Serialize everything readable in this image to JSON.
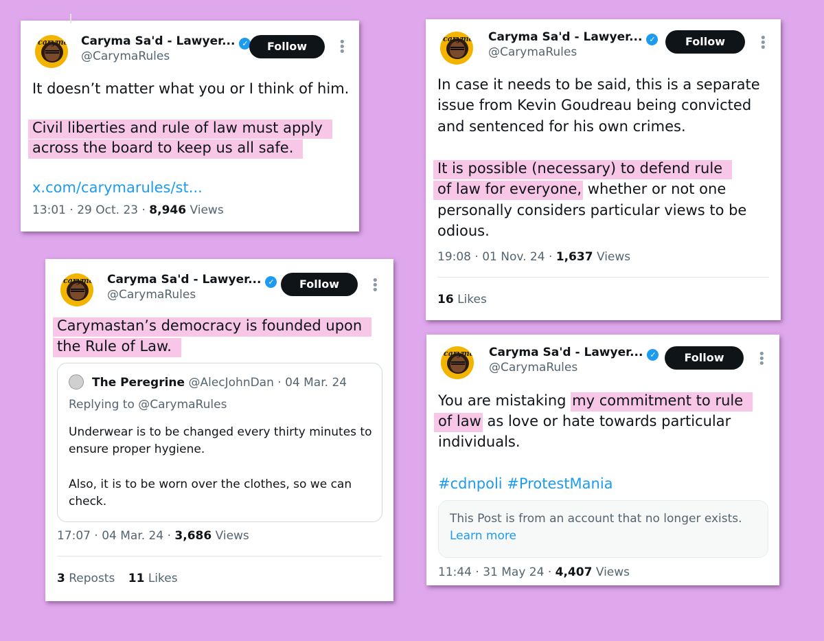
{
  "common": {
    "name": "Caryma Sa'd - Lawyer...",
    "handle": "@CarymaRules",
    "follow": "Follow",
    "verified_icon": "✓",
    "more_icon": "⋮",
    "avatar_text": "caryma",
    "brand_color": "#1d9bf0",
    "highlight_color": "#f8c7e8",
    "background_color": "#dfa7ec"
  },
  "tweet1": {
    "line1": "It doesn’t matter what you or I think of him.",
    "hl_line1": "Civil liberties and rule of law must apply",
    "hl_line2": "across the board to keep us all safe.",
    "link": "x.com/carymarules/st...",
    "time": "13:01 · 29 Oct. 23 ·",
    "views_count": "8,946",
    "views_label": "Views"
  },
  "tweet2": {
    "line1": "In case it needs to be said, this is a separate",
    "line2": "issue from Kevin Goudreau being convicted",
    "line3": "and sentenced for his own crimes.",
    "hl_line1": "It is possible (necessary) to defend rule",
    "hl_line2": "of law for everyone,",
    "line2_rest": " whether or not one",
    "line5": "personally considers particular views to be",
    "line6": "odious.",
    "time": "19:08 · 01 Nov. 24 ·",
    "views_count": "1,637",
    "views_label": "Views",
    "likes_count": "16",
    "likes_label": "Likes"
  },
  "tweet3": {
    "hl_line1": "Carymastan’s democracy is founded upon",
    "hl_line2": "the Rule of Law.",
    "quote": {
      "name": "The Peregrine",
      "meta": "@AlecJohnDan · 04 Mar. 24",
      "reply": "Replying to @CarymaRules",
      "line1": "Underwear is to be changed every thirty minutes to",
      "line2": "ensure proper hygiene.",
      "line3": "Also, it is to be worn over the clothes, so we can",
      "line4": "check."
    },
    "time": "17:07 · 04 Mar. 24 ·",
    "views_count": "3,686",
    "views_label": "Views",
    "reposts_count": "3",
    "reposts_label": "Reposts",
    "likes_count": "11",
    "likes_label": "Likes"
  },
  "tweet4": {
    "line1_a": "You are mistaking ",
    "hl_a": "my commitment to rule",
    "hl_b": "of law",
    "line2_rest": " as love or hate towards particular",
    "line3": "individuals.",
    "hashtags": "#cdnpoli #ProtestMania",
    "notice_line1": "This Post is from an account that no longer exists.",
    "notice_link": "Learn more",
    "time": "11:44 · 31 May 24 ·",
    "views_count": "4,407",
    "views_label": "Views"
  }
}
